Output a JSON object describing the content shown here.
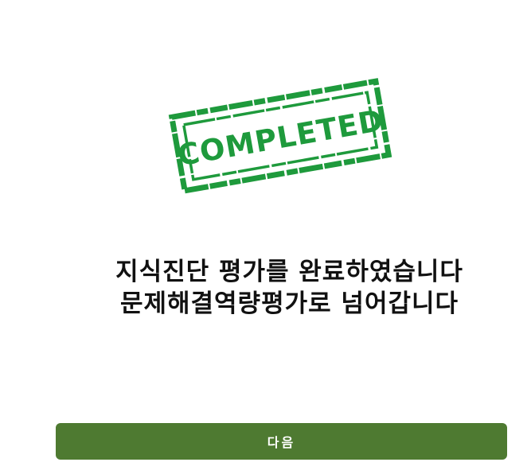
{
  "stamp": {
    "text": "COMPLETED",
    "color": "#1e9a3c"
  },
  "message": {
    "line1": "지식진단 평가를 완료하였습니다",
    "line2": "문제해결역량평가로 넘어갑니다"
  },
  "next_button": {
    "label": "다음",
    "color": "#4e7a31"
  }
}
